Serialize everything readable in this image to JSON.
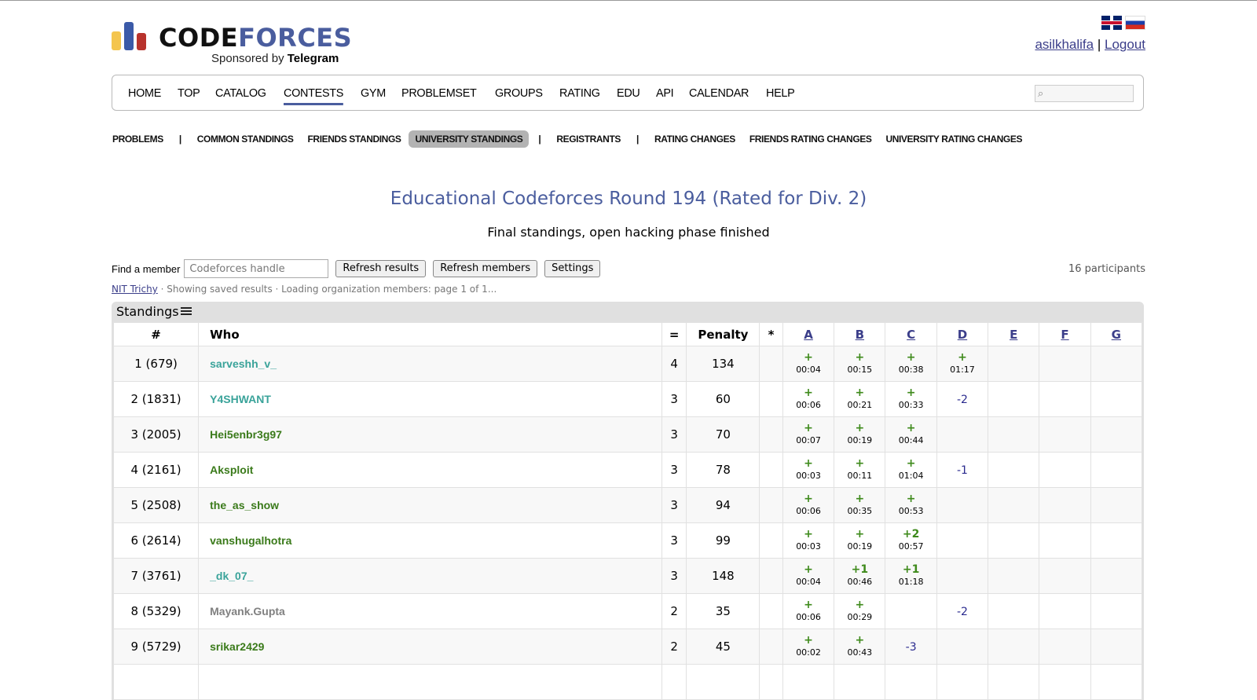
{
  "brand": {
    "word_a": "CODE",
    "word_b": "FORCES",
    "sponsored_prefix": "Sponsored by",
    "sponsor": "Telegram",
    "bar_colors": [
      "#f4c54e",
      "#3b5aa8",
      "#b8332d"
    ]
  },
  "languages": [
    "English",
    "Russian"
  ],
  "user": {
    "handle": "asilkhalifa",
    "separator": "|",
    "logout": "Logout"
  },
  "menu": {
    "items": [
      "HOME",
      "TOP",
      "CATALOG",
      "CONTESTS",
      "GYM",
      "PROBLEMSET",
      "GROUPS",
      "RATING",
      "EDU",
      "API",
      "CALENDAR",
      "HELP"
    ],
    "active": "CONTESTS"
  },
  "submenu": {
    "problems": "PROBLEMS",
    "common": "COMMON STANDINGS",
    "friends": "FRIENDS STANDINGS",
    "university": "UNIVERSITY STANDINGS",
    "registrants": "REGISTRANTS",
    "rating_changes": "RATING CHANGES",
    "friends_rating": "FRIENDS RATING CHANGES",
    "university_rating": "UNIVERSITY RATING CHANGES",
    "sep": "|"
  },
  "contest": {
    "title": "Educational Codeforces Round 194 (Rated for Div. 2)",
    "status": "Final standings, open hacking phase finished"
  },
  "find": {
    "label": "Find a member",
    "placeholder": "Codeforces handle",
    "refresh_results": "Refresh results",
    "refresh_members": "Refresh members",
    "settings": "Settings",
    "participants": "16 participants"
  },
  "org_line": {
    "org": "NIT Trichy",
    "info": " · Showing saved results · Loading organization members: page 1 of 1..."
  },
  "standings": {
    "heading": "Standings",
    "headers": {
      "rank": "#",
      "who": "Who",
      "solved": "=",
      "penalty": "Penalty",
      "hacks": "*"
    },
    "problems": [
      "A",
      "B",
      "C",
      "D",
      "E",
      "F",
      "G"
    ],
    "rows": [
      {
        "rank": "1 (679)",
        "who": "sarveshh_v_",
        "color": "cyan",
        "solved": "4",
        "penalty": "134",
        "results": [
          {
            "s": "+",
            "t": "00:04"
          },
          {
            "s": "+",
            "t": "00:15"
          },
          {
            "s": "+",
            "t": "00:38"
          },
          {
            "s": "+",
            "t": "01:17"
          },
          null,
          null,
          null
        ]
      },
      {
        "rank": "2 (1831)",
        "who": "Y4SHWANT",
        "color": "cyan",
        "solved": "3",
        "penalty": "60",
        "results": [
          {
            "s": "+",
            "t": "00:06"
          },
          {
            "s": "+",
            "t": "00:21"
          },
          {
            "s": "+",
            "t": "00:33"
          },
          {
            "n": "-2"
          },
          null,
          null,
          null
        ]
      },
      {
        "rank": "3 (2005)",
        "who": "Hei5enbr3g97",
        "color": "green",
        "solved": "3",
        "penalty": "70",
        "results": [
          {
            "s": "+",
            "t": "00:07"
          },
          {
            "s": "+",
            "t": "00:19"
          },
          {
            "s": "+",
            "t": "00:44"
          },
          null,
          null,
          null,
          null
        ]
      },
      {
        "rank": "4 (2161)",
        "who": "Aksploit",
        "color": "green",
        "solved": "3",
        "penalty": "78",
        "results": [
          {
            "s": "+",
            "t": "00:03"
          },
          {
            "s": "+",
            "t": "00:11"
          },
          {
            "s": "+",
            "t": "01:04"
          },
          {
            "n": "-1"
          },
          null,
          null,
          null
        ]
      },
      {
        "rank": "5 (2508)",
        "who": "the_as_show",
        "color": "green",
        "solved": "3",
        "penalty": "94",
        "results": [
          {
            "s": "+",
            "t": "00:06"
          },
          {
            "s": "+",
            "t": "00:35"
          },
          {
            "s": "+",
            "t": "00:53"
          },
          null,
          null,
          null,
          null
        ]
      },
      {
        "rank": "6 (2614)",
        "who": "vanshugalhotra",
        "color": "green",
        "solved": "3",
        "penalty": "99",
        "results": [
          {
            "s": "+",
            "t": "00:03"
          },
          {
            "s": "+",
            "t": "00:19"
          },
          {
            "s": "+2",
            "t": "00:57"
          },
          null,
          null,
          null,
          null
        ]
      },
      {
        "rank": "7 (3761)",
        "who": "_dk_07_",
        "color": "cyan",
        "solved": "3",
        "penalty": "148",
        "results": [
          {
            "s": "+",
            "t": "00:04"
          },
          {
            "s": "+1",
            "t": "00:46"
          },
          {
            "s": "+1",
            "t": "01:18"
          },
          null,
          null,
          null,
          null
        ]
      },
      {
        "rank": "8 (5329)",
        "who": "Mayank.Gupta",
        "color": "gray",
        "solved": "2",
        "penalty": "35",
        "results": [
          {
            "s": "+",
            "t": "00:06"
          },
          {
            "s": "+",
            "t": "00:29"
          },
          null,
          {
            "n": "-2"
          },
          null,
          null,
          null
        ]
      },
      {
        "rank": "9 (5729)",
        "who": "srikar2429",
        "color": "green",
        "solved": "2",
        "penalty": "45",
        "results": [
          {
            "s": "+",
            "t": "00:02"
          },
          {
            "s": "+",
            "t": "00:43"
          },
          {
            "n": "-3"
          },
          null,
          null,
          null,
          null
        ]
      },
      {
        "rank": "",
        "who": "",
        "color": "gray",
        "solved": "",
        "penalty": "",
        "results": [
          null,
          null,
          null,
          null,
          null,
          null,
          null
        ]
      }
    ]
  }
}
